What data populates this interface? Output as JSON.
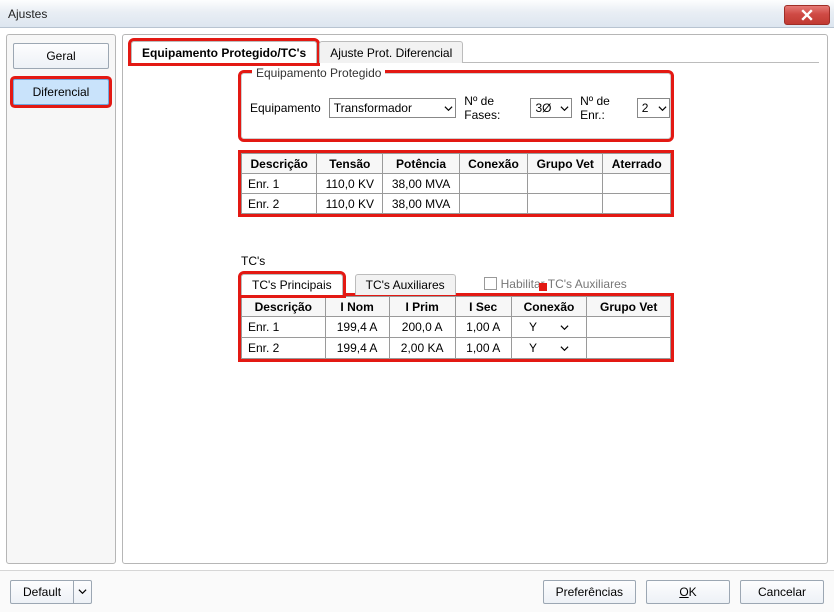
{
  "window": {
    "title": "Ajustes"
  },
  "sidebar": {
    "items": [
      {
        "label": "Geral",
        "selected": false
      },
      {
        "label": "Diferencial",
        "selected": true
      }
    ]
  },
  "tabs": {
    "main": [
      {
        "label": "Equipamento Protegido/TC's",
        "active": true
      },
      {
        "label": "Ajuste Prot. Diferencial",
        "active": false
      }
    ]
  },
  "equip_box": {
    "legend": "Equipamento Protegido",
    "equip_label": "Equipamento",
    "equip_value": "Transformador",
    "fases_label": "Nº de Fases:",
    "fases_value": "3Ø",
    "enr_label": "Nº de Enr.:",
    "enr_value": "2"
  },
  "equip_table": {
    "headers": [
      "Descrição",
      "Tensão",
      "Potência",
      "Conexão",
      "Grupo Vet",
      "Aterrado"
    ],
    "rows": [
      {
        "c0": "Enr. 1",
        "c1": "110,0 KV",
        "c2": "38,00 MVA",
        "c3": "",
        "c4": "",
        "c5": ""
      },
      {
        "c0": "Enr. 2",
        "c1": "110,0 KV",
        "c2": "38,00 MVA",
        "c3": "",
        "c4": "",
        "c5": ""
      }
    ]
  },
  "tc_section": {
    "title": "TC's",
    "sub_tabs": [
      {
        "label": "TC's Principais",
        "active": true
      },
      {
        "label": "TC's Auxiliares",
        "active": false
      }
    ],
    "chk_label": "Habilitar TC's Auxiliares",
    "chk_checked": false,
    "headers": [
      "Descrição",
      "I Nom",
      "I Prim",
      "I Sec",
      "Conexão",
      "Grupo Vet"
    ],
    "rows": [
      {
        "c0": "Enr. 1",
        "c1": "199,4 A",
        "c2": "200,0 A",
        "c3": "1,00 A",
        "c4": "Y",
        "c5": ""
      },
      {
        "c0": "Enr. 2",
        "c1": "199,4 A",
        "c2": "2,00 KA",
        "c3": "1,00 A",
        "c4": "Y",
        "c5": ""
      }
    ]
  },
  "bottom": {
    "default_label": "Default",
    "pref_label": "Preferências",
    "ok_label_pre": "",
    "ok_underline": "O",
    "ok_label_post": "K",
    "cancel_label": "Cancelar"
  }
}
